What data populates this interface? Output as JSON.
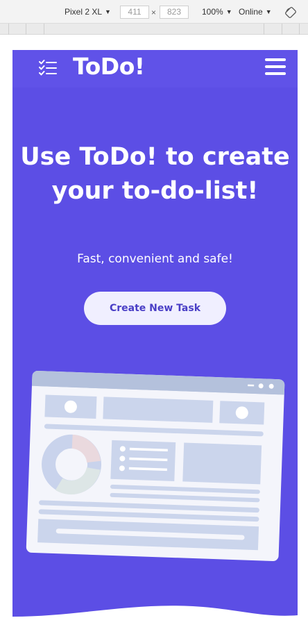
{
  "devtools": {
    "device": "Pixel 2 XL",
    "width": "411",
    "height": "823",
    "zoom": "100%",
    "throttle": "Online",
    "times": "×"
  },
  "navbar": {
    "brand": "ToDo!",
    "logo_icon": "checklist-icon",
    "menu_icon": "hamburger-menu-icon"
  },
  "hero": {
    "title": "Use ToDo! to create your to-do-list!",
    "subtitle": "Fast, convenient and safe!",
    "cta_label": "Create New Task"
  },
  "illustration": {
    "icon": "dashboard-illustration"
  },
  "colors": {
    "primary": "#5c4ee5",
    "navbar": "#6052e8",
    "button_bg": "#f0efff",
    "button_text": "#4a3fc6"
  }
}
